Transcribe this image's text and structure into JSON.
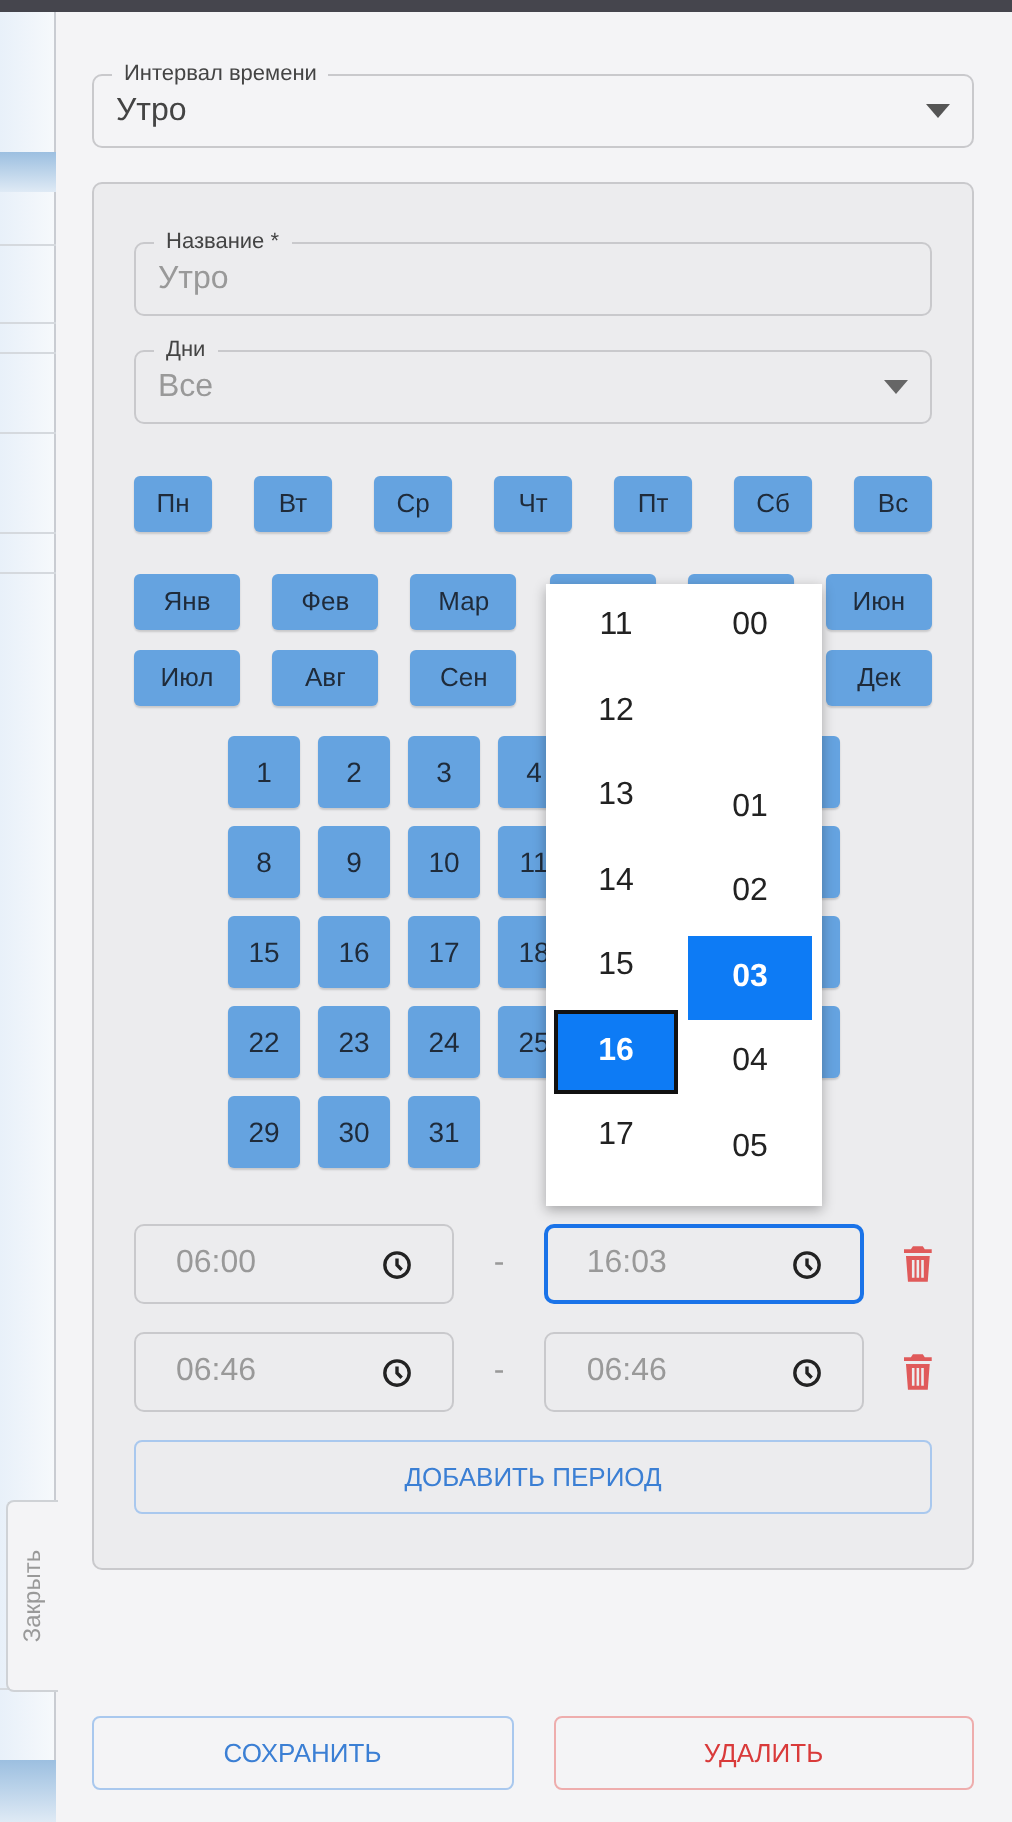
{
  "interval_select": {
    "label": "Интервал времени",
    "value": "Утро",
    "disabled": false
  },
  "name_field": {
    "label": "Название *",
    "value": "Утро",
    "disabled": true
  },
  "days_select": {
    "label": "Дни",
    "value": "Все",
    "disabled": true
  },
  "weekdays": [
    "Пн",
    "Вт",
    "Ср",
    "Чт",
    "Пт",
    "Сб",
    "Вс"
  ],
  "months": [
    [
      {
        "kind": "chip",
        "label": "Янв"
      },
      {
        "kind": "chip",
        "label": "Фев"
      },
      {
        "kind": "chip",
        "label": "Мар"
      },
      {
        "kind": "covered"
      },
      {
        "kind": "covered"
      },
      {
        "kind": "chip",
        "label": "Июн"
      }
    ],
    [
      {
        "kind": "chip",
        "label": "Июл"
      },
      {
        "kind": "chip",
        "label": "Авг"
      },
      {
        "kind": "chip",
        "label": "Сен"
      },
      {
        "kind": "hidden"
      },
      {
        "kind": "hidden"
      },
      {
        "kind": "chip",
        "label": "Дек"
      }
    ]
  ],
  "days": [
    [
      {
        "kind": "chip",
        "label": "1"
      },
      {
        "kind": "chip",
        "label": "2"
      },
      {
        "kind": "chip",
        "label": "3"
      },
      {
        "kind": "chip",
        "label": "4"
      },
      {
        "kind": "hidden"
      },
      {
        "kind": "hidden"
      },
      {
        "kind": "covered"
      }
    ],
    [
      {
        "kind": "chip",
        "label": "8"
      },
      {
        "kind": "chip",
        "label": "9"
      },
      {
        "kind": "chip",
        "label": "10"
      },
      {
        "kind": "chip",
        "label": "11"
      },
      {
        "kind": "hidden"
      },
      {
        "kind": "hidden"
      },
      {
        "kind": "covered"
      }
    ],
    [
      {
        "kind": "chip",
        "label": "15"
      },
      {
        "kind": "chip",
        "label": "16"
      },
      {
        "kind": "chip",
        "label": "17"
      },
      {
        "kind": "chip",
        "label": "18"
      },
      {
        "kind": "hidden"
      },
      {
        "kind": "hidden"
      },
      {
        "kind": "covered"
      }
    ],
    [
      {
        "kind": "chip",
        "label": "22"
      },
      {
        "kind": "chip",
        "label": "23"
      },
      {
        "kind": "chip",
        "label": "24"
      },
      {
        "kind": "chip",
        "label": "25"
      },
      {
        "kind": "hidden"
      },
      {
        "kind": "hidden"
      },
      {
        "kind": "covered"
      }
    ],
    [
      {
        "kind": "chip",
        "label": "29"
      },
      {
        "kind": "chip",
        "label": "30"
      },
      {
        "kind": "chip",
        "label": "31"
      }
    ]
  ],
  "time_picker": {
    "hours": [
      {
        "label": "11",
        "selected": false
      },
      {
        "label": "12",
        "selected": false
      },
      {
        "label": "13",
        "selected": false
      },
      {
        "label": "14",
        "selected": false
      },
      {
        "label": "15",
        "selected": false
      },
      {
        "label": "16",
        "selected": true
      },
      {
        "label": "17",
        "selected": false
      }
    ],
    "minutes": [
      {
        "label": "00",
        "selected": false
      },
      {
        "label": "01",
        "selected": false
      },
      {
        "label": "02",
        "selected": false
      },
      {
        "label": "03",
        "selected": true
      },
      {
        "label": "04",
        "selected": false
      },
      {
        "label": "05",
        "selected": false
      }
    ]
  },
  "periods": [
    {
      "start": "06:00",
      "end": "16:03",
      "separator": "-",
      "end_focused": true
    },
    {
      "start": "06:46",
      "end": "06:46",
      "separator": "-",
      "end_focused": false
    }
  ],
  "add_period_button": "ДОБАВИТЬ ПЕРИОД",
  "side_tab": "Закрыть",
  "save_button": "СОХРАНИТЬ",
  "delete_button": "УДАЛИТЬ"
}
